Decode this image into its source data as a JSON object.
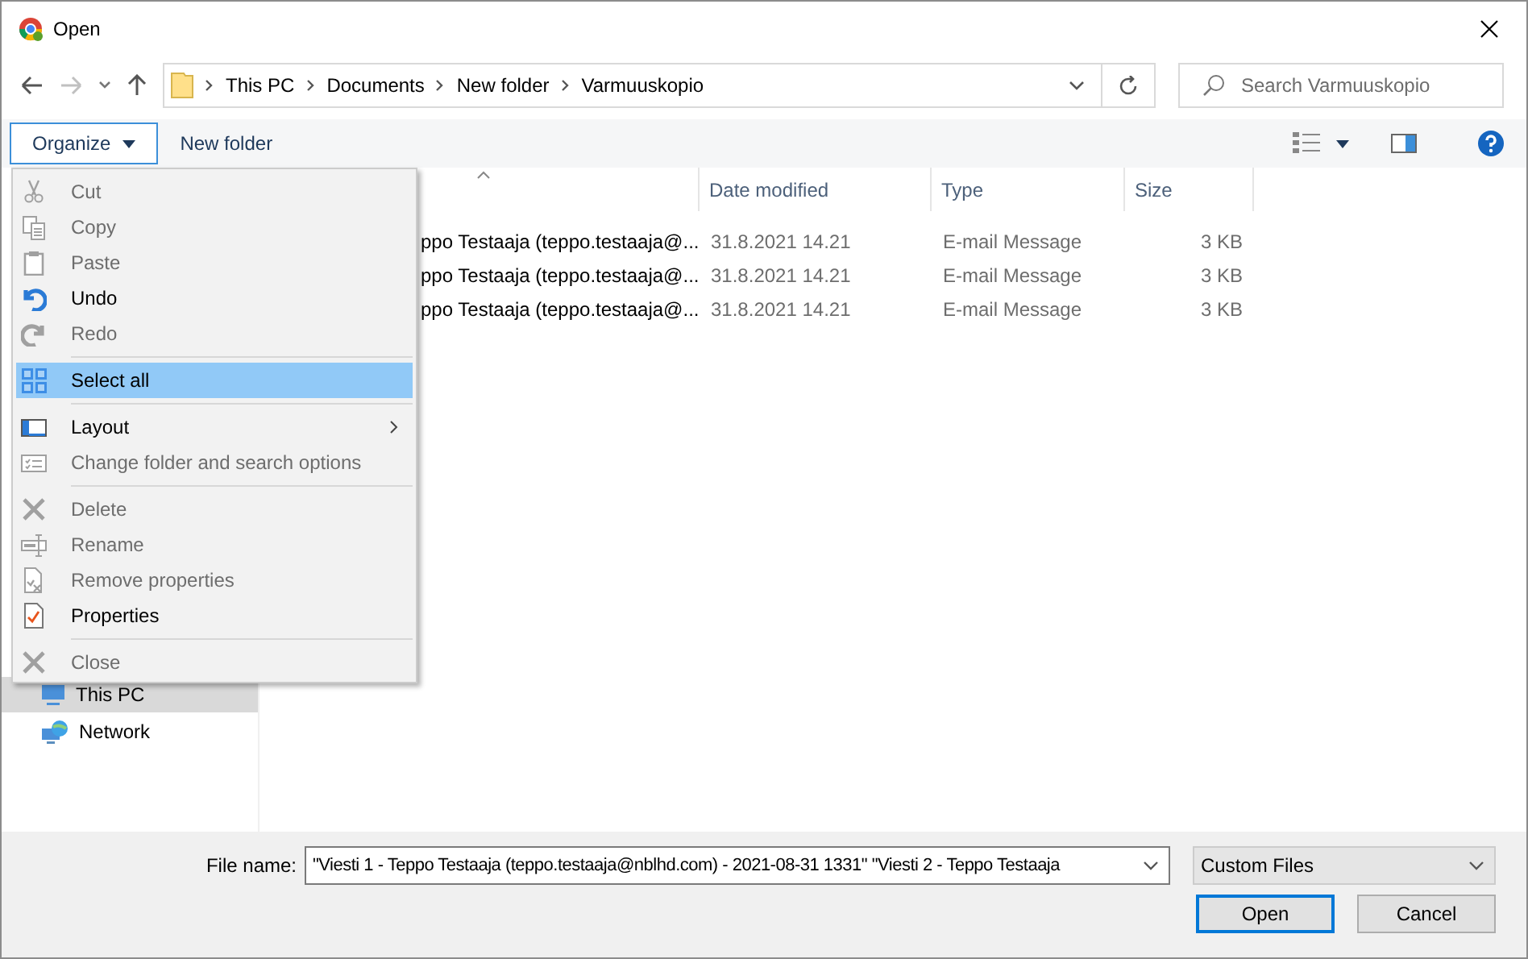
{
  "window": {
    "title": "Open"
  },
  "address": {
    "path": [
      "This PC",
      "Documents",
      "New folder",
      "Varmuuskopio"
    ]
  },
  "search": {
    "placeholder": "Search Varmuuskopio"
  },
  "toolbar": {
    "organize": {
      "label": "Organize",
      "expanded": true
    },
    "new_folder": "New folder"
  },
  "menu": [
    {
      "kind": "item",
      "label": "Cut",
      "disabled": true,
      "selected": false
    },
    {
      "kind": "item",
      "label": "Copy",
      "disabled": true,
      "selected": false
    },
    {
      "kind": "item",
      "label": "Paste",
      "disabled": true,
      "selected": false
    },
    {
      "kind": "item",
      "label": "Undo",
      "disabled": false,
      "selected": false
    },
    {
      "kind": "item",
      "label": "Redo",
      "disabled": true,
      "selected": false
    },
    {
      "kind": "separator"
    },
    {
      "kind": "item",
      "label": "Select all",
      "disabled": false,
      "selected": true
    },
    {
      "kind": "separator"
    },
    {
      "kind": "submenu",
      "label": "Layout",
      "disabled": false,
      "selected": false
    },
    {
      "kind": "item",
      "label": "Change folder and search options",
      "disabled": true,
      "selected": false
    },
    {
      "kind": "separator"
    },
    {
      "kind": "item",
      "label": "Delete",
      "disabled": true,
      "selected": false
    },
    {
      "kind": "item",
      "label": "Rename",
      "disabled": true,
      "selected": false
    },
    {
      "kind": "item",
      "label": "Remove properties",
      "disabled": true,
      "selected": false
    },
    {
      "kind": "item",
      "label": "Properties",
      "disabled": false,
      "selected": false
    },
    {
      "kind": "separator"
    },
    {
      "kind": "item",
      "label": "Close",
      "disabled": true,
      "selected": false
    }
  ],
  "navigation": [
    {
      "label": "This PC",
      "selected": true
    },
    {
      "label": "Network",
      "selected": false
    }
  ],
  "file_list": {
    "columns": [
      "Date modified",
      "Type",
      "Size"
    ],
    "rows": [
      {
        "name": "ppo Testaaja (teppo.testaaja@...",
        "date": "31.8.2021 14.21",
        "type": "E-mail Message",
        "size": "3 KB"
      },
      {
        "name": "ppo Testaaja (teppo.testaaja@...",
        "date": "31.8.2021 14.21",
        "type": "E-mail Message",
        "size": "3 KB"
      },
      {
        "name": "ppo Testaaja (teppo.testaaja@...",
        "date": "31.8.2021 14.21",
        "type": "E-mail Message",
        "size": "3 KB"
      }
    ]
  },
  "footer": {
    "file_name_label": "File name:",
    "file_name": "\"Viesti 1 - Teppo Testaaja (teppo.testaaja@nblhd.com) - 2021-08-31 1331\" \"Viesti 2 - Teppo Testaaja",
    "filter": "Custom Files",
    "buttons": [
      {
        "label": "Open",
        "default": true
      },
      {
        "label": "Cancel",
        "default": false
      }
    ]
  }
}
